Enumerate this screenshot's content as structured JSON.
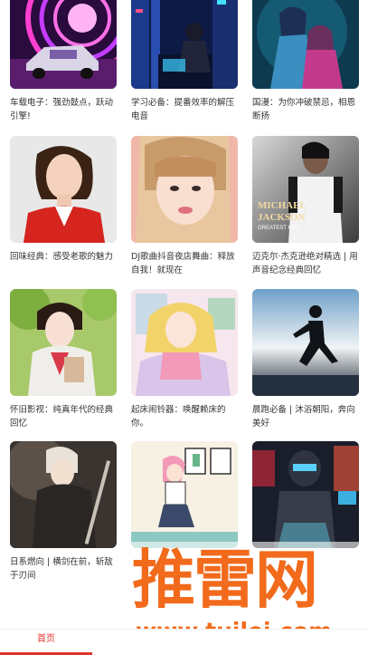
{
  "playlists": [
    {
      "title": "车载电子：强劲鼓点，跃动引擎!",
      "cover": "car-neon-cover"
    },
    {
      "title": "学习必备：提番效率的解压电音",
      "cover": "city-night-cover"
    },
    {
      "title": "国漫：为你冲破禁忌，相恩断扬",
      "cover": "anime-couple-cover"
    },
    {
      "title": "回味经典：感受老歌的魅力",
      "cover": "woman-red-cover"
    },
    {
      "title": "DJ歌曲抖音夜店舞曲：释放自我！就现在",
      "cover": "woman-portrait-cover"
    },
    {
      "title": "迈克尔·杰克逊绝对精选 | 用声音纪念经典回忆",
      "cover": "michael-jackson-cover",
      "cover_text": [
        "MICHAEL",
        "JACKSON",
        "GREATEST HITS"
      ]
    },
    {
      "title": "怀旧影视：纯真年代的经典回忆",
      "cover": "drama-woman-cover"
    },
    {
      "title": "起床闹铃器：唤醒赖床的你。",
      "cover": "sailor-moon-cover"
    },
    {
      "title": "晨跑必备 | 沐浴朝阳，奔向美好",
      "cover": "runner-cover"
    },
    {
      "title": "日系燃向 | 横剑在前，斩敌于刃间",
      "cover": "knight-cover"
    },
    {
      "title": "",
      "cover": "dancer-illustration-cover"
    },
    {
      "title": "",
      "cover": "robot-city-cover"
    }
  ],
  "watermark": {
    "logo": "推雷网",
    "url": "www.tuilei.com"
  },
  "tabbar": {
    "home_label": "首页"
  },
  "colors": {
    "accent": "#e0342c",
    "watermark": "#f26a1b"
  }
}
